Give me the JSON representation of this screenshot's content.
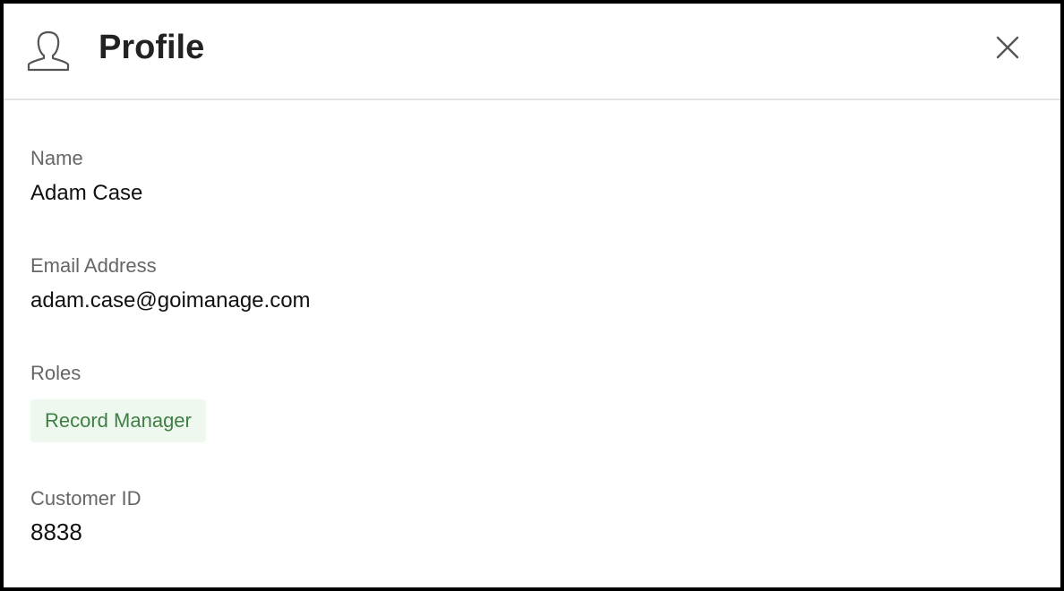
{
  "header": {
    "icon": "user-profile-icon",
    "title": "Profile",
    "close_icon": "close-icon"
  },
  "fields": {
    "name": {
      "label": "Name",
      "value": "Adam Case"
    },
    "email": {
      "label": "Email Address",
      "value": "adam.case@goimanage.com"
    },
    "roles": {
      "label": "Roles",
      "items": [
        "Record Manager"
      ]
    },
    "customer_id": {
      "label": "Customer ID",
      "value": "8838"
    }
  },
  "colors": {
    "title_text": "#222222",
    "label_text": "#666666",
    "value_text": "#111111",
    "chip_background": "#eef8ef",
    "chip_text": "#3f7f45",
    "divider": "#e3e3e3"
  }
}
